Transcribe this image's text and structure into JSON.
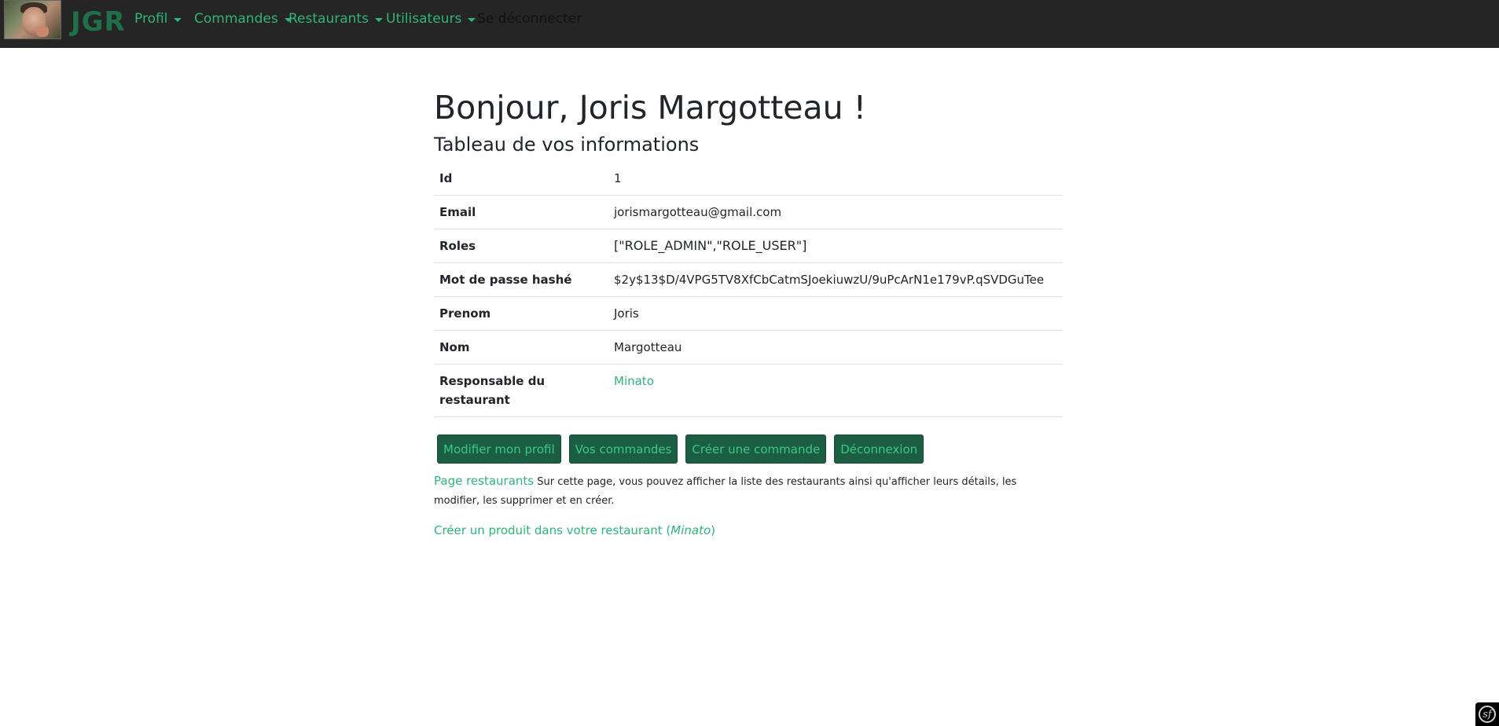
{
  "navbar": {
    "brand": "JGR",
    "items": [
      {
        "label": "Profil"
      },
      {
        "label": "Commandes"
      },
      {
        "label": "Restaurants"
      },
      {
        "label": "Utilisateurs"
      }
    ],
    "logout_label": "Se déconnecter"
  },
  "main": {
    "title": "Bonjour, Joris Margotteau !",
    "subtitle": "Tableau de vos informations",
    "table": [
      {
        "label": "Id",
        "value": "1"
      },
      {
        "label": "Email",
        "value": "jorismargotteau@gmail.com"
      },
      {
        "label": "Roles",
        "value": "[\"ROLE_ADMIN\",\"ROLE_USER\"]"
      },
      {
        "label": "Mot de passe hashé",
        "value": "$2y$13$D/4VPG5TV8XfCbCatmSJoekiuwzU/9uPcArN1e179vP.qSVDGuTee"
      },
      {
        "label": "Prenom",
        "value": "Joris"
      },
      {
        "label": "Nom",
        "value": "Margotteau"
      },
      {
        "label": "Responsable du restaurant",
        "value": "Minato"
      }
    ],
    "buttons": {
      "edit_profile": "Modifier mon profil",
      "my_orders": "Vos commandes",
      "create_order": "Créer une commande",
      "logout": "Déconnexion"
    },
    "restaurants_link": "Page restaurants",
    "restaurants_desc": " Sur cette page, vous pouvez afficher la liste des restaurants ainsi qu'afficher leurs détails, les modifier, les supprimer et en créer.",
    "create_product_prefix": "Créer un produit dans votre restaurant (",
    "create_product_restaurant": "Minato",
    "create_product_suffix": ")"
  },
  "colors": {
    "navbar_bg": "#252525",
    "accent": "#2fb47a",
    "button_bg": "#1b5e43"
  },
  "corner_badge_icon": "symfony-icon"
}
